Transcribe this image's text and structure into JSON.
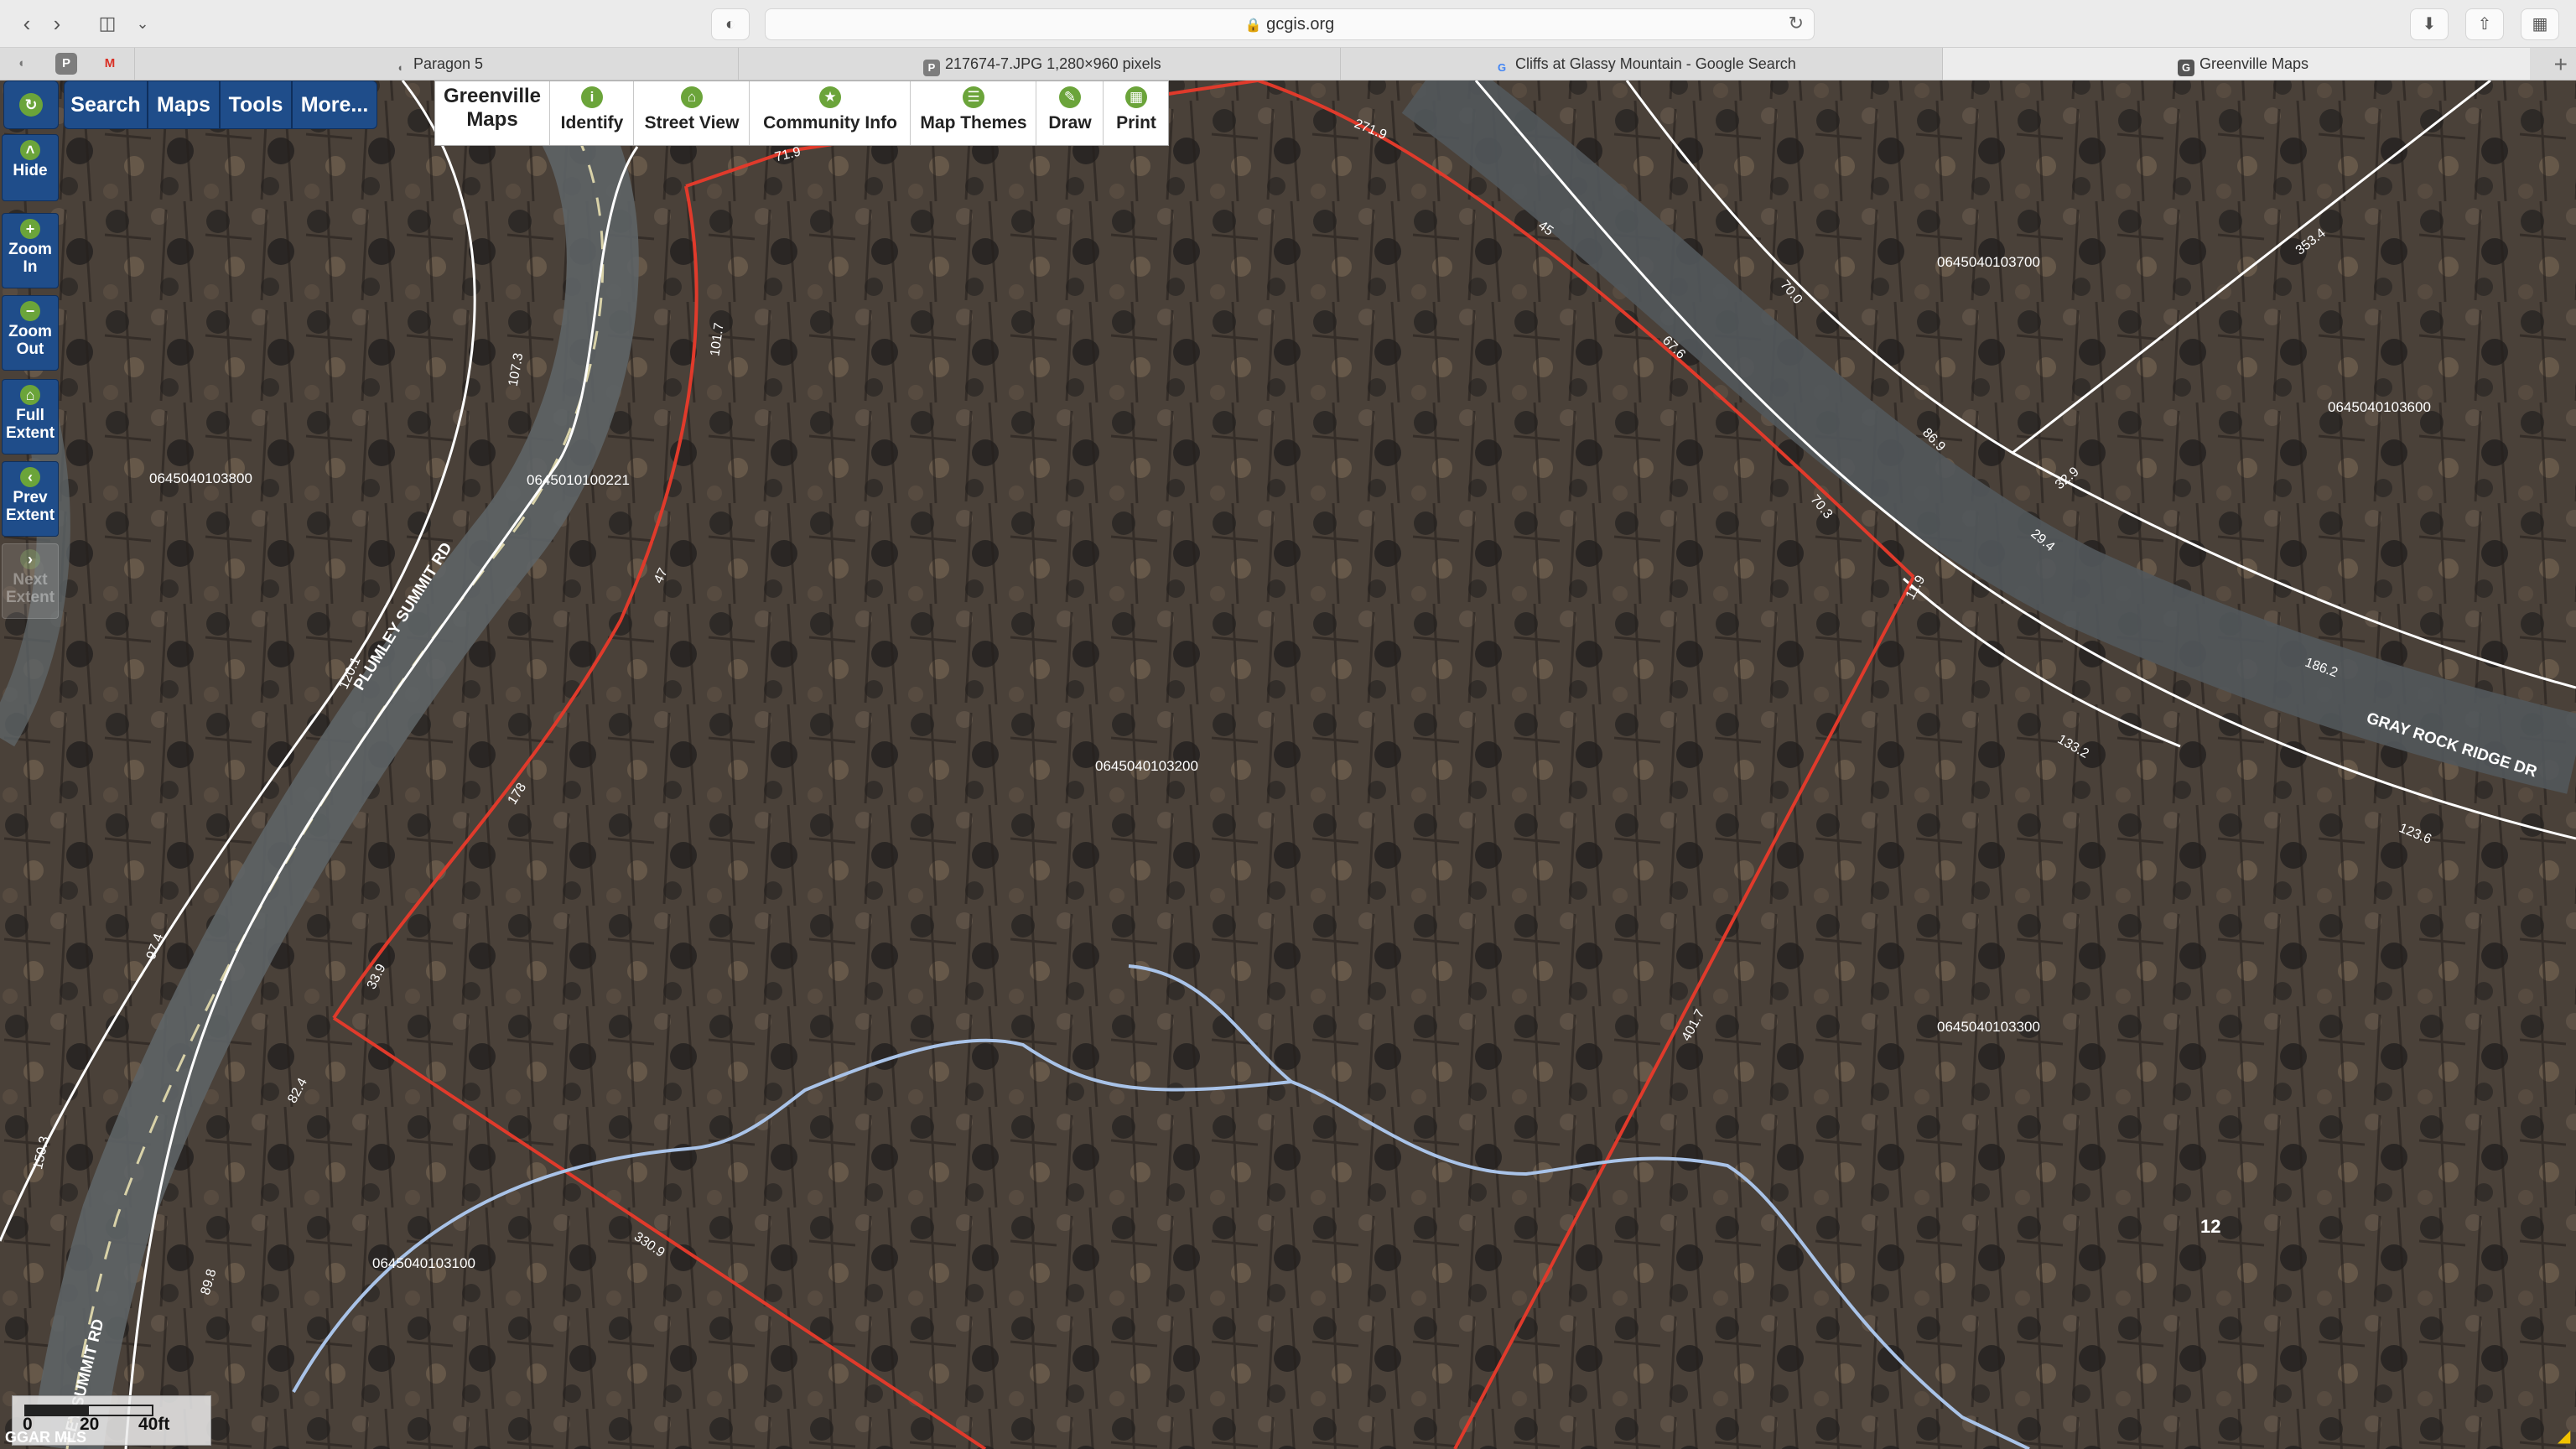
{
  "browser": {
    "url": "gcgis.org",
    "tabs": [
      {
        "label": "Paragon 5"
      },
      {
        "label": "217674-7.JPG 1,280×960 pixels"
      },
      {
        "label": "Cliffs at Glassy Mountain - Google Search"
      },
      {
        "label": "Greenville Maps"
      }
    ],
    "pinned": [
      "P",
      "M"
    ]
  },
  "app": {
    "menu": {
      "search": "Search",
      "maps": "Maps",
      "tools": "Tools",
      "more": "More..."
    },
    "title_line1": "Greenville",
    "title_line2": "Maps",
    "tools": {
      "identify": "Identify",
      "street_view": "Street View",
      "community_info": "Community Info",
      "map_themes": "Map Themes",
      "draw": "Draw",
      "print": "Print"
    },
    "nav": {
      "hide": "Hide",
      "zoom_in_1": "Zoom",
      "zoom_in_2": "In",
      "zoom_out_1": "Zoom",
      "zoom_out_2": "Out",
      "full_extent_1": "Full",
      "full_extent_2": "Extent",
      "prev_extent_1": "Prev",
      "prev_extent_2": "Extent",
      "next_extent_1": "Next",
      "next_extent_2": "Extent"
    }
  },
  "map": {
    "parcels": {
      "p1": "0645040103800",
      "p2": "0645010100221",
      "p3": "0645040103200",
      "p4": "0645040103700",
      "p5": "0645040103600",
      "p6": "0645040103300",
      "p7": "0645040103100"
    },
    "lot_number": "12",
    "roads": {
      "r1": "PLUMLEY SUMMIT RD",
      "r2": "GRAY ROCK RIDGE DR",
      "r3": "LEY SUMMIT RD"
    },
    "dims": {
      "d1": "71.9",
      "d2": "271.9",
      "d3": "45",
      "d4": "67.6",
      "d5": "70.3",
      "d6": "11.9",
      "d7": "101.7",
      "d8": "47",
      "d9": "178",
      "d10": "33.9",
      "d11": "330.9",
      "d12": "401.7",
      "d13": "70.0",
      "d14": "86.9",
      "d15": "29.4",
      "d16": "32.9",
      "d17": "186.2",
      "d18": "133.2",
      "d19": "123.6",
      "d20": "353.4",
      "d21": "107.3",
      "d22": "120.1",
      "d23": "97.4",
      "d24": "82.4",
      "d25": "89.8",
      "d26": "150.3"
    },
    "scale": {
      "zero": "0",
      "mid": "20",
      "end": "40ft"
    },
    "watermark": "GGAR MLS"
  },
  "colors": {
    "nav_blue": "#1f4d8a",
    "green_icon": "#6ba43a",
    "parcel_red": "#e03a2b",
    "stream_blue": "#a9c3e8"
  }
}
